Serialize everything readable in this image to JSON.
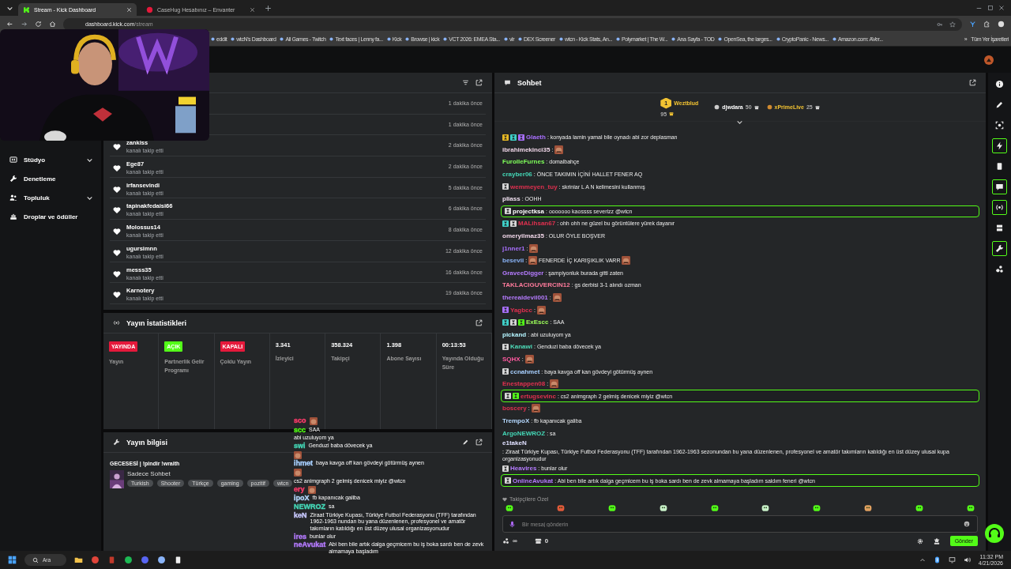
{
  "browser": {
    "tabs": [
      {
        "title": "Stream - Kick Dashboard",
        "selected": true
      },
      {
        "title": "CaseHug Hesabınız – Envanter",
        "selected": false
      }
    ],
    "url_host": "dashboard.kick.com",
    "url_path": "/stream",
    "bookmarks": [
      "eddit",
      "wtcN's Dashboard",
      "All Games - Twitch",
      "Text faces | Lenny fa...",
      "Kick",
      "Browse | kick",
      "VCT 2026: EMEA Sta...",
      "vlr",
      "DEX Screener",
      "wtcn - Kick Stats, An...",
      "Polymarket | The W...",
      "Ana Sayfa - TOD",
      "OpenSea, the larges...",
      "CryptoPanic - News...",
      "Amazon.com: AVer..."
    ],
    "bookmarks_more": "»",
    "all_bookmarks": "Tüm Yer İşaretleri"
  },
  "sidebar": [
    {
      "label": "Stüdyo",
      "kind": "studio",
      "expandable": true
    },
    {
      "label": "Denetleme",
      "kind": "wrench",
      "expandable": false
    },
    {
      "label": "Topluluk",
      "kind": "users",
      "expandable": true
    },
    {
      "label": "Droplar ve ödüller",
      "kind": "gift",
      "expandable": false
    }
  ],
  "follows": [
    {
      "time": "1 dakika önce"
    },
    {
      "time": "1 dakika önce"
    },
    {
      "name": "zankiss",
      "action": "kanalı takip etti",
      "time": "2 dakika önce"
    },
    {
      "name": "Ege87",
      "action": "kanalı takip etti",
      "time": "2 dakika önce"
    },
    {
      "name": "irfansevindi",
      "action": "kanalı takip etti",
      "time": "5 dakika önce"
    },
    {
      "name": "tapinakfedaisi66",
      "action": "kanalı takip etti",
      "time": "6 dakika önce"
    },
    {
      "name": "Molossus14",
      "action": "kanalı takip etti",
      "time": "8 dakika önce"
    },
    {
      "name": "ugursimnn",
      "action": "kanalı takip etti",
      "time": "12 dakika önce"
    },
    {
      "name": "messs35",
      "action": "kanalı takip etti",
      "time": "16 dakika önce"
    },
    {
      "name": "Karnotery",
      "action": "kanalı takip etti",
      "time": "19 dakika önce"
    }
  ],
  "stats": {
    "title": "Yayın İstatistikleri",
    "cells": [
      {
        "kind": "badge",
        "badge": "YAYINDA",
        "color": "#e5193b",
        "label": "Yayın"
      },
      {
        "kind": "badge",
        "badge": "AÇIK",
        "color": "#53fc18",
        "label": "Partnerlik Gelir Programı"
      },
      {
        "kind": "badge",
        "badge": "KAPALI",
        "color": "#e5193b",
        "label": "Çoklu Yayın"
      },
      {
        "kind": "number",
        "value": "3.341",
        "label": "İzleyici"
      },
      {
        "kind": "number",
        "value": "358.324",
        "label": "Takipçi"
      },
      {
        "kind": "number",
        "value": "1.398",
        "label": "Abone Sayısı"
      },
      {
        "kind": "number",
        "value": "00:13:53",
        "label": "Yayında Olduğu Süre"
      }
    ]
  },
  "info": {
    "title": "Yayın bilgisi",
    "stream_title": "GECESESİ | !pindir !wraith",
    "category": "Sadece Sohbet",
    "tags": [
      "Turkish",
      "Shooter",
      "Türkçe",
      "gaming",
      "pozitif",
      "wtcn"
    ]
  },
  "overlay": [
    {
      "user": "sco",
      "color": "#ff3b6b",
      "emote": true
    },
    {
      "user": "scc",
      "color": "#53fc18",
      "text": "SAA"
    },
    {
      "text": "abi uzuluyom ya"
    },
    {
      "user": "swi",
      "color": "#44d7b6",
      "text": "Genduzi baba dövecek ya"
    },
    {
      "emote": true
    },
    {
      "user": "ihmet",
      "color": "#a8d0ff",
      "text": "baya kavga off kan gövdeyi götürmüş aynen"
    },
    {
      "emote": true
    },
    {
      "text": "cs2 animgraph 2 gelmiş denicek miyiz @wtcn"
    },
    {
      "user": "ery",
      "color": "#ff3b6b",
      "emote": true
    },
    {
      "user": "ipoX",
      "color": "#b5d8ff",
      "text": "fb kapanıcak galiba"
    },
    {
      "user": "NEWROZ",
      "color": "#44d7b6",
      "text": "sa"
    },
    {
      "user": "keN",
      "color": "#c9c9ff",
      "text": "Ziraat Türkiye Kupası, Türkiye Futbol Federasyonu (TFF) tarafından 1962-1963 nundan bu yana düzenlenen, profesyonel ve amatör takımların katıldığı en üst düzey ulusal organizasyonudur"
    },
    {
      "user": "ires",
      "color": "#b57bff",
      "text": "bunlar olur"
    },
    {
      "user": "neAvukat",
      "color": "#b57bff",
      "text": "Abi ben bile artık dalga geçmicem bu iş boka sardı ben de zevk almamaya başladım"
    }
  ],
  "chat": {
    "title": "Sohbet",
    "leaders": [
      {
        "rank": "1",
        "name": "Weztblud",
        "count": "95"
      },
      {
        "name": "djwdara",
        "count": "50"
      },
      {
        "name": "xPrimeLive",
        "count": "25"
      }
    ],
    "messages": [
      {
        "badges": [
          {
            "kind": "crown"
          },
          {
            "kind": "og"
          },
          {
            "kind": "subp"
          }
        ],
        "user": "Glaeth",
        "color": "#a970ff",
        "parts": [
          {
            "kind": "text",
            "text": ": konyada lamin yamal bile oynadı abi zor deplasman"
          }
        ],
        "highlighted": false
      },
      {
        "user": "ibrahimekinci35",
        "color": "#f0d6e8",
        "parts": [
          {
            "kind": "text",
            "text": ":"
          },
          {
            "kind": "emote"
          }
        ],
        "highlighted": false
      },
      {
        "user": "FurolleFurnes",
        "color": "#7fff5a",
        "parts": [
          {
            "kind": "text",
            "text": ": domalbahçe"
          }
        ],
        "highlighted": false
      },
      {
        "user": "crayber06",
        "color": "#44d7b6",
        "parts": [
          {
            "kind": "text",
            "text": ": ÖNCE TAKIMIN İÇİNİ HALLET FENER AQ"
          }
        ],
        "highlighted": false
      },
      {
        "badges": [
          {
            "kind": "sub"
          }
        ],
        "user": "wemmeyen_tuy",
        "color": "#e0304f",
        "parts": [
          {
            "kind": "text",
            "text": ": skriniar L A N kelimesini kullanmış"
          }
        ],
        "highlighted": false
      },
      {
        "user": "pliass",
        "color": "#f0e0f0",
        "parts": [
          {
            "kind": "text",
            "text": ": OOHH"
          }
        ],
        "highlighted": false
      },
      {
        "badges": [
          {
            "kind": "sub"
          }
        ],
        "user": "projectksa",
        "color": "#ffffff",
        "parts": [
          {
            "kind": "text",
            "text": ": ooooooo kaossss severizz @wtcn"
          }
        ],
        "highlighted": true
      },
      {
        "badges": [
          {
            "kind": "og"
          },
          {
            "kind": "sub"
          }
        ],
        "user": "MALihsan67",
        "color": "#e0304f",
        "parts": [
          {
            "kind": "text",
            "text": ": ohh ohh ne güzel bu görüntülere yürek dayanır"
          }
        ],
        "highlighted": false
      },
      {
        "user": "omeryilmaz35",
        "color": "#f0d6e8",
        "parts": [
          {
            "kind": "text",
            "text": ": OLUR ÖYLE BOŞVER"
          }
        ],
        "highlighted": false
      },
      {
        "user": "j1nner1",
        "color": "#a970ff",
        "parts": [
          {
            "kind": "text",
            "text": ":"
          },
          {
            "kind": "emote"
          }
        ],
        "highlighted": false
      },
      {
        "user": "besevii",
        "color": "#8ab4f8",
        "parts": [
          {
            "kind": "text",
            "text": ":"
          },
          {
            "kind": "emote"
          },
          {
            "kind": "text",
            "text": "FENERDE İÇ KARIŞIKLIK VARR"
          },
          {
            "kind": "emote"
          }
        ],
        "highlighted": false
      },
      {
        "user": "GraveeDigger",
        "color": "#b57bff",
        "parts": [
          {
            "kind": "text",
            "text": ": şampiyonluk burada gitti zaten"
          }
        ],
        "highlighted": false
      },
      {
        "user": "TAKLACIGUVERCIN12",
        "color": "#ff7b9c",
        "parts": [
          {
            "kind": "text",
            "text": ": gs derbisi 3-1 alındı ozman"
          }
        ],
        "highlighted": false
      },
      {
        "user": "therealdevil001",
        "color": "#b57bff",
        "parts": [
          {
            "kind": "text",
            "text": ":"
          },
          {
            "kind": "emote"
          }
        ],
        "highlighted": false
      },
      {
        "badges": [
          {
            "kind": "subp"
          }
        ],
        "user": "Yagbcc",
        "color": "#e0304f",
        "parts": [
          {
            "kind": "text",
            "text": ":"
          },
          {
            "kind": "emote"
          }
        ],
        "highlighted": false
      },
      {
        "badges": [
          {
            "kind": "og"
          },
          {
            "kind": "sub"
          },
          {
            "kind": "gift"
          }
        ],
        "user": "ExEscc",
        "color": "#9dff5a",
        "parts": [
          {
            "kind": "text",
            "text": ": SAA"
          }
        ],
        "highlighted": false
      },
      {
        "user": "pickand",
        "color": "#b5f5ff",
        "parts": [
          {
            "kind": "text",
            "text": ": abi uzuluyom ya"
          }
        ],
        "highlighted": false
      },
      {
        "badges": [
          {
            "kind": "sub"
          }
        ],
        "user": "Kanawi",
        "color": "#4ddbb8",
        "parts": [
          {
            "kind": "text",
            "text": ": Genduzi baba dövecek ya"
          }
        ],
        "highlighted": false
      },
      {
        "user": "SQHX",
        "color": "#ff5aa0",
        "parts": [
          {
            "kind": "text",
            "text": ":"
          },
          {
            "kind": "emote"
          }
        ],
        "highlighted": false
      },
      {
        "badges": [
          {
            "kind": "sub"
          }
        ],
        "user": "ccnahmet",
        "color": "#a8d0ff",
        "parts": [
          {
            "kind": "text",
            "text": ": baya kavga off kan gövdeyi götürmüş aynen"
          }
        ],
        "highlighted": false
      },
      {
        "user": "Enestappen08",
        "color": "#e0304f",
        "parts": [
          {
            "kind": "text",
            "text": ":"
          },
          {
            "kind": "emote"
          }
        ],
        "highlighted": false
      },
      {
        "badges": [
          {
            "kind": "sub"
          },
          {
            "kind": "gift"
          }
        ],
        "user": "ertugsevinc",
        "color": "#e0304f",
        "parts": [
          {
            "kind": "text",
            "text": ": cs2 animgraph 2 gelmiş denicek miyiz @wtcn"
          }
        ],
        "highlighted": true
      },
      {
        "user": "boscery",
        "color": "#e0304f",
        "parts": [
          {
            "kind": "text",
            "text": ":"
          },
          {
            "kind": "emote"
          }
        ],
        "highlighted": false
      },
      {
        "user": "TrempoX",
        "color": "#b5d8ff",
        "parts": [
          {
            "kind": "text",
            "text": ": fb kapanıcak galiba"
          }
        ],
        "highlighted": false
      },
      {
        "user": "ArgoNEWROZ",
        "color": "#44d7b6",
        "parts": [
          {
            "kind": "text",
            "text": ": sa"
          }
        ],
        "highlighted": false
      },
      {
        "user": "e1takeN",
        "color": "#e0e0ff",
        "parts": [
          {
            "kind": "text",
            "text": ": Ziraat Türkiye Kupası, Türkiye Futbol Federasyonu (TFF) tarafından 1962-1963 sezonundan bu yana düzenlenen, profesyonel ve amatör takımların katıldığı en üst düzey ulusal kupa organizasyonudur"
          }
        ],
        "highlighted": false
      },
      {
        "badges": [
          {
            "kind": "sub"
          }
        ],
        "user": "Heavires",
        "color": "#b57bff",
        "parts": [
          {
            "kind": "text",
            "text": ": bunlar olur"
          }
        ],
        "highlighted": false
      },
      {
        "badges": [
          {
            "kind": "sub"
          }
        ],
        "user": "OnlineAvukat",
        "color": "#b57bff",
        "parts": [
          {
            "kind": "text",
            "text": ": Abi ben bile artık dalga geçmicem bu iş boka sardı ben de zevk almamaya başladım saldım feneri @wtcn"
          }
        ],
        "highlighted": true
      }
    ],
    "followers_only": "Takipçilere Özel",
    "placeholder": "Bir mesaj gönderin",
    "points": "∞",
    "cart": "0",
    "send": "Gönder"
  },
  "rail": [
    {
      "kind": "info",
      "highlighted": false
    },
    {
      "kind": "pencil",
      "highlighted": false
    },
    {
      "kind": "focus",
      "highlighted": false
    },
    {
      "kind": "bolt",
      "highlighted": true
    },
    {
      "kind": "note",
      "highlighted": false
    },
    {
      "kind": "chat",
      "highlighted": true
    },
    {
      "kind": "broadcast",
      "highlighted": true
    },
    {
      "kind": "cards",
      "highlighted": false
    },
    {
      "kind": "wrench",
      "highlighted": true
    },
    {
      "kind": "dots",
      "highlighted": false
    }
  ],
  "taskbar": {
    "search": "Ara",
    "time": "11:32 PM",
    "date": "4/21/2026"
  }
}
